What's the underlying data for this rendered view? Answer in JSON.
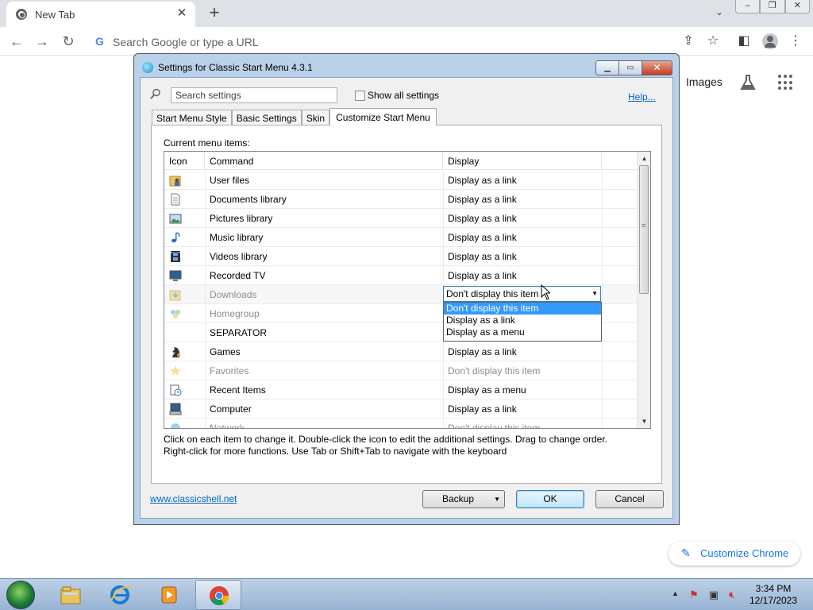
{
  "browser": {
    "tab_title": "New Tab",
    "omnibox_placeholder": "Search Google or type a URL",
    "ntp_images_label": "Images",
    "customize_label": "Customize Chrome"
  },
  "dialog": {
    "title": "Settings for Classic Start Menu 4.3.1",
    "search_placeholder": "Search settings",
    "show_all_label": "Show all settings",
    "help_link": "Help...",
    "tabs": [
      "Start Menu Style",
      "Basic Settings",
      "Skin",
      "Customize Start Menu"
    ],
    "current_label": "Current menu items:",
    "columns": {
      "icon": "Icon",
      "command": "Command",
      "display": "Display"
    },
    "rows": [
      {
        "command": "User files",
        "display": "Display as a link",
        "icon": "user-folder-icon"
      },
      {
        "command": "Documents library",
        "display": "Display as a link",
        "icon": "document-icon"
      },
      {
        "command": "Pictures library",
        "display": "Display as a link",
        "icon": "picture-icon"
      },
      {
        "command": "Music library",
        "display": "Display as a link",
        "icon": "music-note-icon"
      },
      {
        "command": "Videos library",
        "display": "Display as a link",
        "icon": "film-icon"
      },
      {
        "command": "Recorded TV",
        "display": "Display as a link",
        "icon": "monitor-icon"
      },
      {
        "command": "Downloads",
        "display": "",
        "icon": "downloads-folder-icon"
      },
      {
        "command": "Homegroup",
        "display": "",
        "icon": "homegroup-icon"
      },
      {
        "command": "SEPARATOR",
        "display": "",
        "icon": ""
      },
      {
        "command": "Games",
        "display": "Display as a link",
        "icon": "chess-knight-icon"
      },
      {
        "command": "Favorites",
        "display": "Don't display this item",
        "icon": "star-icon"
      },
      {
        "command": "Recent Items",
        "display": "Display as a menu",
        "icon": "recent-items-icon"
      },
      {
        "command": "Computer",
        "display": "Display as a link",
        "icon": "computer-icon"
      },
      {
        "command": "Network",
        "display": "Don't display this item",
        "icon": "network-icon"
      }
    ],
    "combo_value": "Don't display this item",
    "dropdown_options": [
      "Don't display this item",
      "Display as a link",
      "Display as a menu"
    ],
    "help_text_1": "Click on each item to change it. Double-click the icon to edit the additional settings. Drag to change order.",
    "help_text_2": "Right-click for more functions. Use Tab or Shift+Tab to navigate with the keyboard",
    "site_link": "www.classicshell.net",
    "backup_label": "Backup",
    "ok_label": "OK",
    "cancel_label": "Cancel"
  },
  "taskbar": {
    "time": "3:34 PM",
    "date": "12/17/2023"
  }
}
